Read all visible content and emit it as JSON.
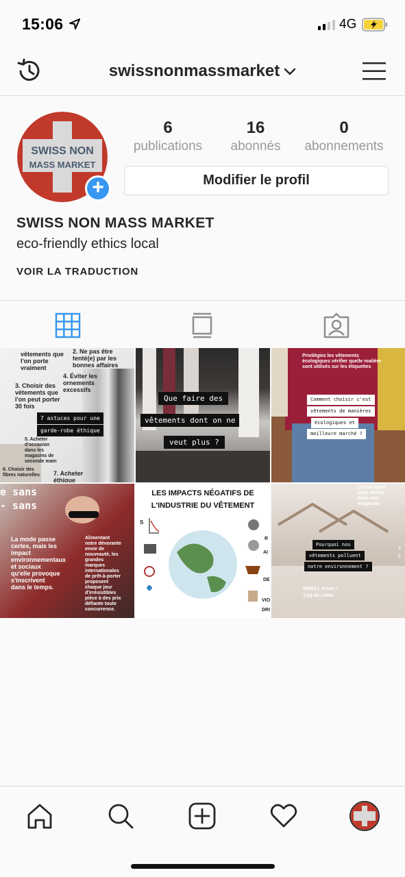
{
  "status_bar": {
    "time": "15:06",
    "network": "4G"
  },
  "header": {
    "username": "swissnonmassmarket"
  },
  "profile": {
    "avatar_text_line1": "SWISS NON",
    "avatar_text_line2": "MASS MARKET",
    "stats": [
      {
        "value": "6",
        "label": "publications"
      },
      {
        "value": "16",
        "label": "abonnés"
      },
      {
        "value": "0",
        "label": "abonnements"
      }
    ],
    "edit_button": "Modifier le profil",
    "name": "SWISS NON MASS MARKET",
    "bio": "eco-friendly ethics local",
    "translate": "VOIR LA TRADUCTION"
  },
  "tabs": [
    {
      "name": "grid",
      "icon": "grid-icon",
      "active": true
    },
    {
      "name": "feed",
      "icon": "feed-icon",
      "active": false
    },
    {
      "name": "tagged",
      "icon": "tagged-icon",
      "active": false
    }
  ],
  "posts": [
    {
      "lines": [
        "vêtements que",
        "l'on porte",
        "vraiment",
        "2. Ne pas être",
        "tenté(e) par les",
        "bonnes affaires",
        "4. Éviter les",
        "ornements",
        "excessifs",
        "3. Choisir des",
        "vêtements que",
        "l'on peut porter",
        "30 fois",
        "7 astuces pour une",
        "garde-robe éthique",
        "5. Acheter",
        "d'occasion",
        "dans les",
        "magasins de",
        "seconde main",
        "6. Choisir des",
        "fibres naturelles",
        "7. Acheter",
        "éthique"
      ]
    },
    {
      "lines": [
        "Que faire des",
        "vêtements dont on ne",
        "veut plus ?"
      ]
    },
    {
      "lines": [
        "Privilégiez les vêtements",
        "écologiques vérifier quelle matière",
        "sont utilisés sur les étiquettes",
        "Comment choisir c'est",
        "vêtements de manières",
        "écologiques et",
        "meilleure marché ?"
      ]
    },
    {
      "lines": [
        "e sans",
        "- sans",
        "La mode passe",
        "certes, mais les",
        "impact",
        "environnementaux",
        "et sociaux",
        "qu'elle provoque",
        "s'inscrivent",
        "dans le temps.",
        "Alimentant",
        "notre dévorante",
        "envie de",
        "nouveauté, les",
        "grandes",
        "marques",
        "internationales",
        "de prêt-à-porter",
        "proposent",
        "chaque jour",
        "d'irrésistibles",
        "pièce à des prix",
        "défiante toute",
        "concurrence."
      ]
    },
    {
      "lines": [
        "LES IMPACTS NÉGATIFS DE",
        "L'INDUSTRIE DU VÊTEMENT",
        "S",
        "R",
        "AI",
        "DE",
        "VIO",
        "DRO"
      ]
    },
    {
      "lines": [
        "Le transport",
        "pour arriver",
        "dans nos",
        "magasins",
        "Pourquoi nos",
        "vêtements polluent",
        "notre environnement ?",
        "54000 L d'eau =",
        "1 kg de coton",
        "T",
        "L"
      ]
    }
  ],
  "bottom_nav": [
    "home-icon",
    "search-icon",
    "new-post-icon",
    "heart-icon",
    "profile-avatar"
  ],
  "colors": {
    "accent": "#3897f0",
    "avatar_red": "#c0392b",
    "text": "#262626",
    "muted": "#999999"
  }
}
